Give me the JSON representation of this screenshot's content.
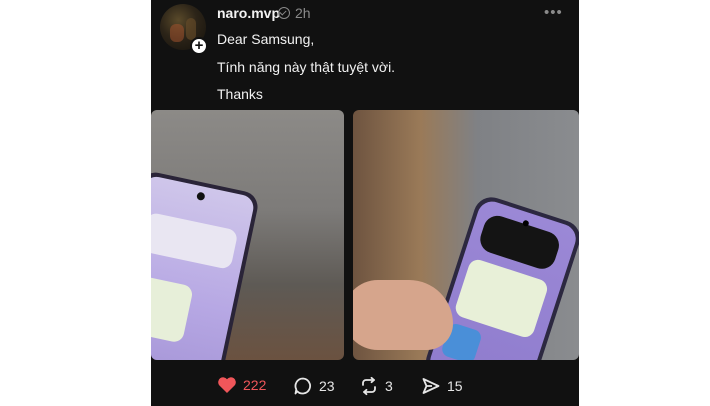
{
  "post": {
    "username": "naro.mvp",
    "time": "2h",
    "lines": [
      "Dear Samsung,",
      "Tính năng này thật tuyệt vời.",
      "Thanks"
    ],
    "images": [
      {
        "name": "photo-phone-closeup-left"
      },
      {
        "name": "photo-phone-in-hand-right"
      }
    ],
    "actions": {
      "likes": "222",
      "comments": "23",
      "reposts": "3",
      "shares": "15"
    },
    "icons": [
      "plus-icon",
      "verified-icon",
      "more-icon",
      "heart-icon",
      "comment-icon",
      "repost-icon",
      "share-icon"
    ],
    "colors": {
      "background": "#111111",
      "like": "#f0565a",
      "text": "#f2f2f2",
      "muted": "#8a8a8a"
    }
  }
}
